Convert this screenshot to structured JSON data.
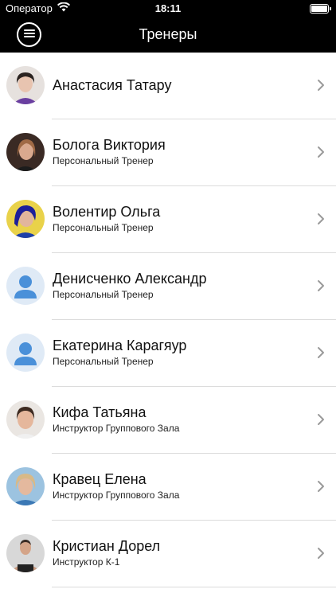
{
  "status_bar": {
    "carrier": "Оператор",
    "time": "18:11",
    "wifi_icon": "wifi-icon",
    "battery_icon": "battery-icon"
  },
  "nav": {
    "title": "Тренеры",
    "menu_icon": "hamburger-menu-icon"
  },
  "trainers": [
    {
      "name": "Анастасия Татару",
      "role": ""
    },
    {
      "name": "Бологa Виктория",
      "role": "Персональный Тренер"
    },
    {
      "name": "Волентир Ольга",
      "role": "Персональный Тренер"
    },
    {
      "name": "Денисченко Александр",
      "role": "Персональный Тренер"
    },
    {
      "name": "Екатерина Карагяур",
      "role": "Персональный Тренер"
    },
    {
      "name": "Кифа Татьяна",
      "role": "Инструктор Группового Зала"
    },
    {
      "name": "Кравец Елена",
      "role": "Инструктор Группового Зала"
    },
    {
      "name": "Кристиан Дорел",
      "role": "Инструктор К-1"
    }
  ]
}
